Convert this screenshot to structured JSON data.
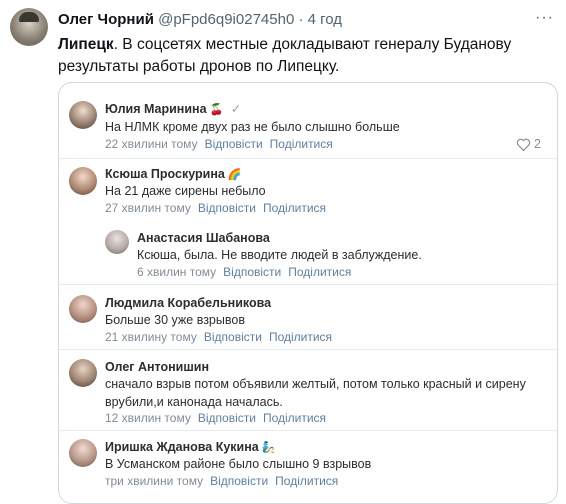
{
  "post": {
    "author": "Олег Чорний",
    "handle": "@pFpd6q9i02745h0",
    "dot": "·",
    "time": "4 год",
    "more": "···",
    "text_bold": "Липецк",
    "text_rest": ". В соцсетях местные докладывают генералу Буданову результаты работы дронов по  Липецку."
  },
  "labels": {
    "reply": "Відповісти",
    "share": "Поділитися"
  },
  "comments": [
    {
      "name": "Юлия Маринина",
      "emoji": "🍒",
      "check": "✓",
      "text": "На НЛМК кроме двух раз не было слышно больше",
      "time": "22 хвилини тому",
      "likes": "2"
    },
    {
      "name": "Ксюша Проскурина",
      "emoji": "🌈",
      "text": "На 21 даже сирены небыло",
      "time": "27 хвилин тому"
    },
    {
      "name": "Анастасия Шабанова",
      "text": "Ксюша, была. Не вводите людей в заблуждение.",
      "time": "6 хвилин тому"
    },
    {
      "name": "Людмила Корабельникова",
      "text": "Больше 30 уже взрывов",
      "time": "21 хвилину тому"
    },
    {
      "name": "Олег Антонишин",
      "text": "сначало взрыв потом объявили желтый, потом только красный и сирену врубили,и канонада началась.",
      "time": "12 хвилин тому"
    },
    {
      "name": "Иришка Жданова Кукина",
      "emoji": "🧞",
      "text": "В Усманском районе было слышно 9 взрывов",
      "time": "три хвилини тому"
    }
  ]
}
